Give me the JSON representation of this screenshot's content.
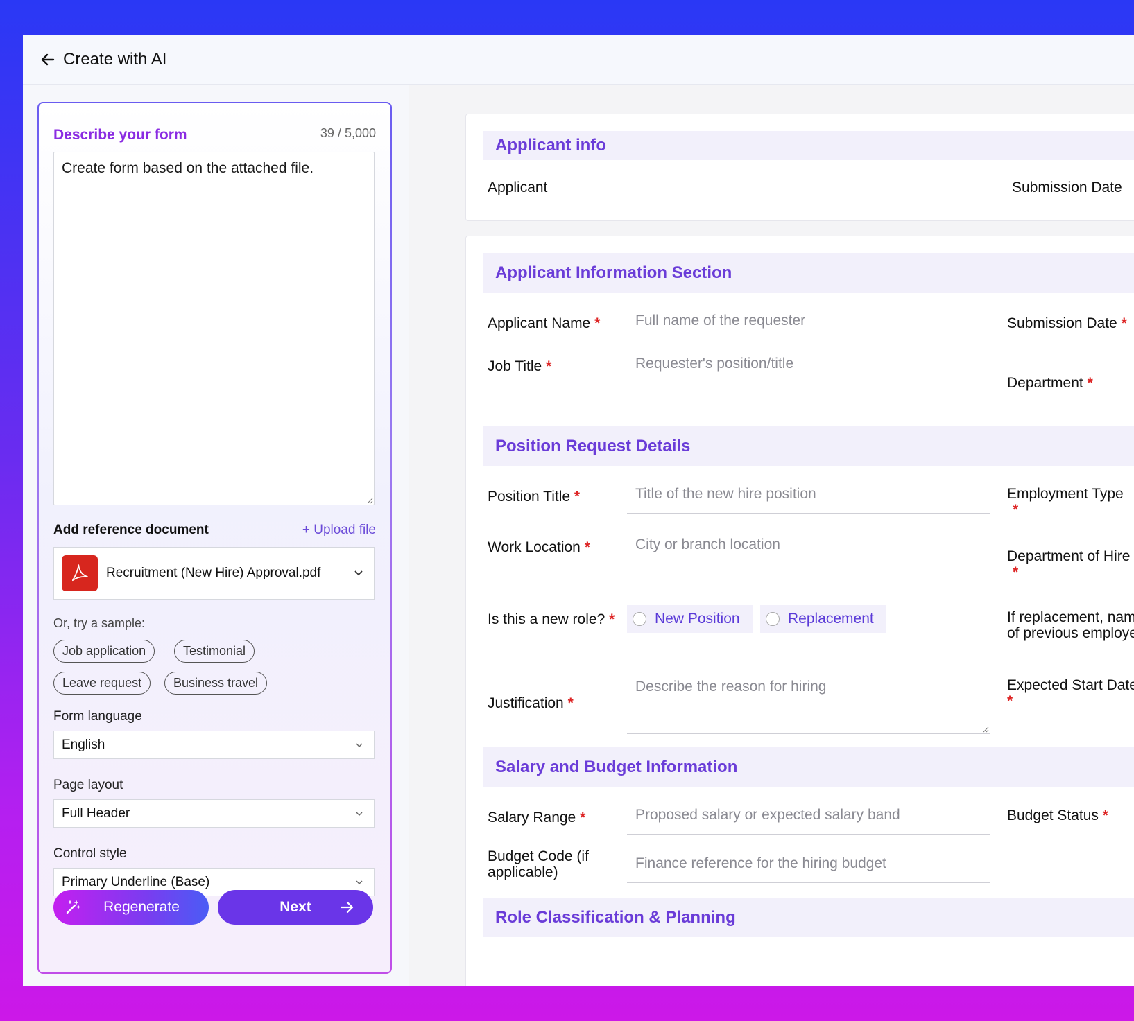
{
  "header": {
    "title": "Create with AI"
  },
  "left": {
    "describe_label": "Describe your form",
    "char_count": "39 / 5,000",
    "prompt": "Create form based on the attached file.",
    "ref_label": "Add reference document",
    "upload_link": "+ Upload file",
    "file_name": "Recruitment (New Hire) Approval.pdf",
    "sample_label": "Or, try a sample:",
    "samples": [
      "Job application",
      "Testimonial",
      "Leave request",
      "Business travel"
    ],
    "language_label": "Form language",
    "language_value": "English",
    "layout_label": "Page layout",
    "layout_value": "Full Header",
    "control_label": "Control style",
    "control_value": "Primary Underline (Base)",
    "regenerate_label": "Regenerate",
    "next_label": "Next"
  },
  "form": {
    "sections": {
      "applicant_info": {
        "title": "Applicant info",
        "applicant": "Applicant",
        "submission_date": "Submission Date"
      },
      "applicant_information": {
        "title": "Applicant Information Section",
        "applicant_name": {
          "label": "Applicant Name",
          "placeholder": "Full name of the requester"
        },
        "job_title": {
          "label": "Job Title",
          "placeholder": "Requester's position/title"
        },
        "submission_date": "Submission Date",
        "department": "Department"
      },
      "position_request": {
        "title": "Position Request Details",
        "position_title": {
          "label": "Position Title",
          "placeholder": "Title of the new hire position"
        },
        "work_location": {
          "label": "Work Location",
          "placeholder": "City or branch location"
        },
        "new_role": {
          "label": "Is this a new role?",
          "options": [
            "New Position",
            "Replacement"
          ]
        },
        "justification": {
          "label": "Justification",
          "placeholder": "Describe the reason for hiring"
        },
        "employment_type": "Employment Type",
        "department_of_hire": "Department of Hire",
        "replacement_name": "If replacement, name of previous employee",
        "expected_start_date": "Expected Start Date"
      },
      "salary_budget": {
        "title": "Salary and Budget Information",
        "salary_range": {
          "label": "Salary Range",
          "placeholder": "Proposed salary or expected salary band"
        },
        "budget_code": {
          "label": "Budget Code (if applicable)",
          "placeholder": "Finance reference for the hiring budget"
        },
        "budget_status": "Budget Status"
      },
      "role_classification": {
        "title": "Role Classification & Planning"
      }
    },
    "required_mark": "*"
  },
  "colors": {
    "accent_purple": "#6a3cd8",
    "required_red": "#dd2222",
    "background_blue": "#2a38f5",
    "background_magenta": "#cc18e8"
  },
  "icons": [
    "back-arrow-icon",
    "pdf-icon",
    "chevron-down-icon",
    "magic-wand-icon",
    "arrow-right-icon",
    "resize-grip-icon"
  ]
}
